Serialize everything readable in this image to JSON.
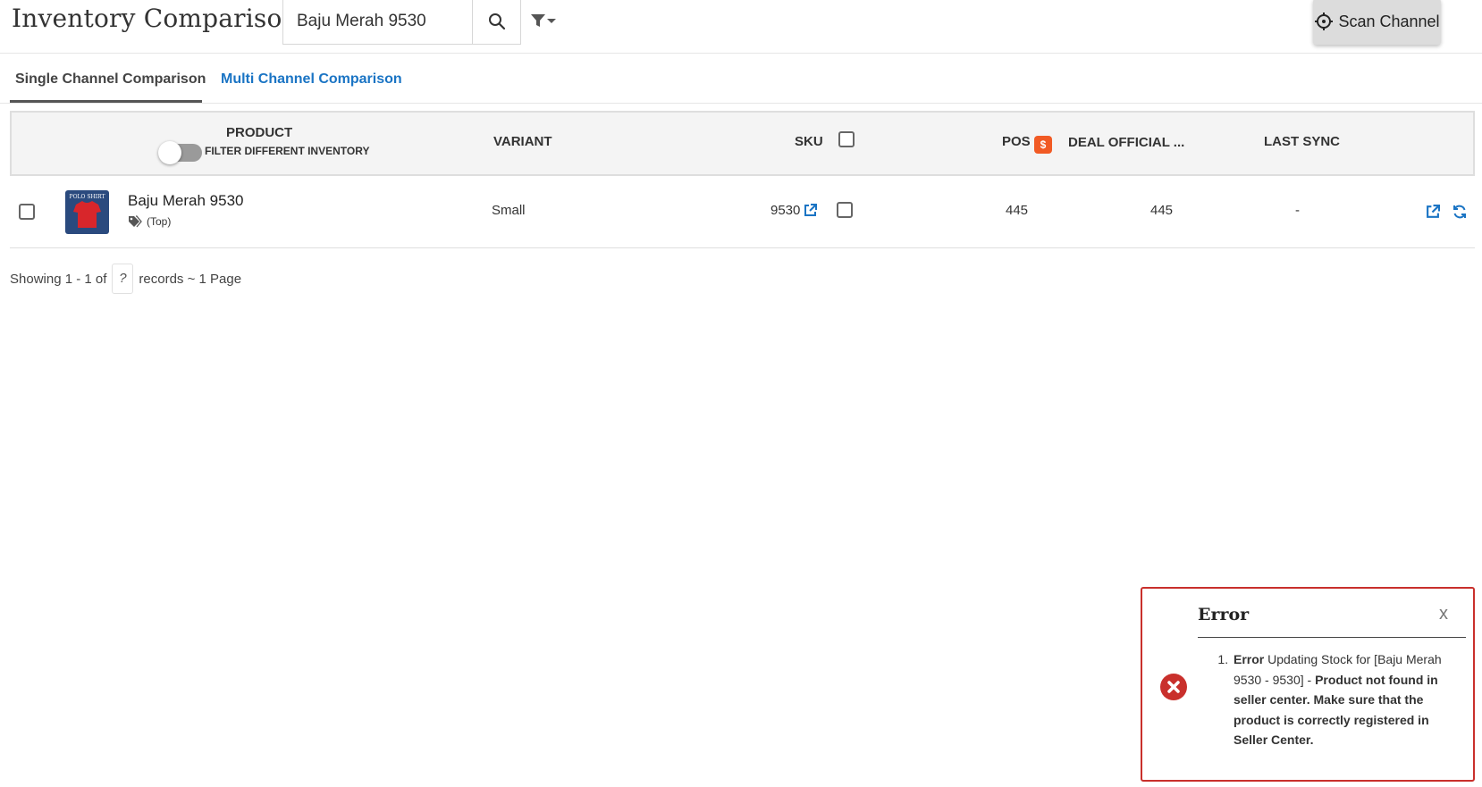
{
  "header": {
    "title": "Inventory Comparison",
    "search_value": "Baju Merah 9530",
    "scan_label": "Scan Channel"
  },
  "tabs": [
    {
      "label": "Single Channel Comparison",
      "active": true
    },
    {
      "label": "Multi Channel Comparison",
      "active": false
    }
  ],
  "table": {
    "columns": {
      "product": "PRODUCT",
      "filter_toggle": "FILTER DIFFERENT INVENTORY",
      "variant": "VARIANT",
      "sku": "SKU",
      "pos": "POS",
      "channel": "DEAL OFFICIAL ...",
      "last_sync": "LAST SYNC"
    },
    "rows": [
      {
        "product_name": "Baju Merah 9530",
        "tag": "(Top)",
        "thumb_text": "POLO SHIRT",
        "variant": "Small",
        "sku": "9530",
        "pos": "445",
        "channel_qty": "445",
        "last_sync": "-"
      }
    ]
  },
  "pagination": {
    "prefix": "Showing 1 - 1 of",
    "unknown": "?",
    "suffix": "records ~ 1 Page"
  },
  "toast": {
    "title": "Error",
    "close": "x",
    "item_bold": "Error",
    "item_text": " Updating Stock for [Baju Merah 9530 - 9530] - ",
    "item_bold2": "Product not found in seller center. Make sure that the product is correctly registered in Seller Center."
  },
  "colors": {
    "accent_link": "#1a74c4",
    "error": "#c9302c",
    "channel_icon": "#f15a24"
  },
  "icons": [
    "search-icon",
    "filter-icon",
    "crosshair-icon",
    "tag-icon",
    "external-link-icon",
    "refresh-icon",
    "error-icon",
    "shopee-icon"
  ]
}
